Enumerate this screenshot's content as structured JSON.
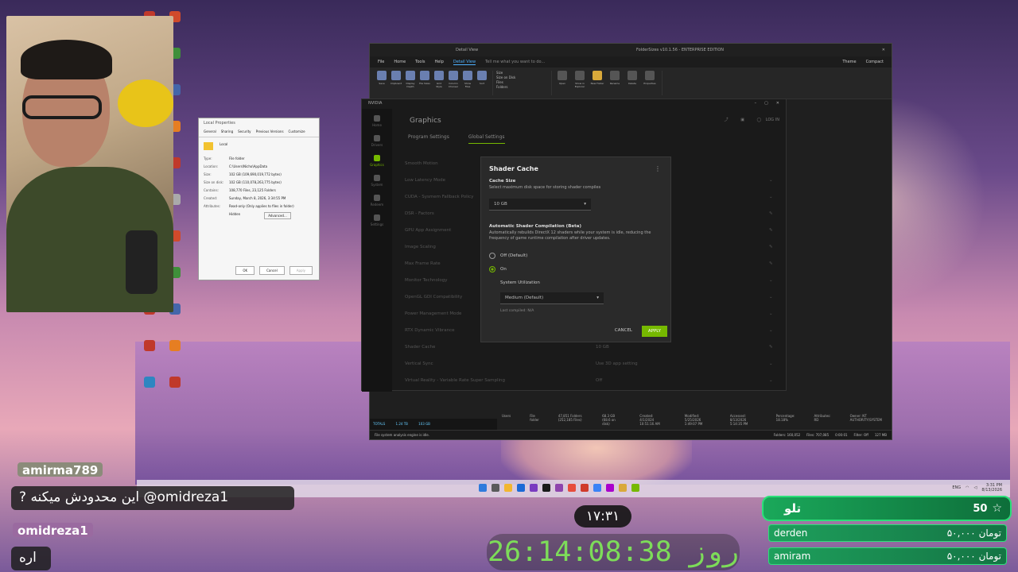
{
  "desktop": {
    "icons": [
      "",
      "",
      "",
      "",
      "",
      "",
      "",
      "",
      "",
      "",
      "",
      "",
      "",
      "",
      "",
      "",
      "",
      "",
      "",
      "",
      "",
      ""
    ]
  },
  "properties_dialog": {
    "title": "Local Properties",
    "tabs": [
      "General",
      "Sharing",
      "Security",
      "Previous Versions",
      "Customize"
    ],
    "folder_name": "Local",
    "rows": [
      {
        "k": "Type:",
        "v": "File folder"
      },
      {
        "k": "Location:",
        "v": "C:\\Users\\Nicho\\AppData"
      },
      {
        "k": "Size:",
        "v": "102 GB (109,690,019,772 bytes)"
      },
      {
        "k": "Size on disk:",
        "v": "102 GB (110,078,263,775 bytes)"
      },
      {
        "k": "Contains:",
        "v": "108,770 Files, 23,125 Folders"
      },
      {
        "k": "Created:",
        "v": "Sunday, March 8, 2026, 3:34:55 PM"
      },
      {
        "k": "Attributes:",
        "v": "Read-only (Only applies to files in folder)"
      }
    ],
    "hidden_label": "Hidden",
    "advanced_label": "Advanced...",
    "ok": "OK",
    "cancel": "Cancel",
    "apply": "Apply"
  },
  "foldersizes": {
    "title": "FolderSizes v10.1.56 - ENTERPRISE EDITION",
    "ribbon_tab": "Detail View",
    "search_placeholder": "Tell me what you want to do...",
    "theme": "Theme",
    "compact": "Compact",
    "menu": [
      "File",
      "Home",
      "Tools",
      "Help",
      "Detail View"
    ],
    "ribbon_buttons": [
      "Save",
      "Clipboard",
      "Display Depth",
      "File Sizes",
      "Grid Style",
      "Column Chooser",
      "Show Files",
      "Sort"
    ],
    "ribbon_checks": [
      "Size",
      "Size on Disk",
      "Files",
      "Folders"
    ],
    "ribbon_actions": [
      "Open",
      "Show in Explorer",
      "New Folder",
      "Rename",
      "Delete",
      "Properties"
    ],
    "group_labels": [
      "Detail Report",
      "Heat Tint",
      "Actions"
    ],
    "bottom_left": [
      "TOTALS",
      "1.24 TB",
      "103 GB"
    ],
    "info": [
      "Users",
      "File folder",
      "47,851 Folders (252,185 Files)",
      "68.3 GB (68.6 on disk)",
      "Created: 4/1/2024 10:51:16 AM",
      "Modified: 5/25/2026 1:49:07 PM",
      "Accessed: 8/13/2026 5:14:35 PM",
      "Percentage: 18.18%",
      "Attributes: RD",
      "Owner: NT AUTHORITY\\SYSTEM"
    ],
    "status": "File system analysis engine is idle.",
    "status_right": [
      "Folders: 160,052",
      "Files: 707,085",
      "0:00:01",
      "Filter: Off",
      "127 MB"
    ]
  },
  "nvidia": {
    "brand": "NVIDIA",
    "header": "Graphics",
    "login": "LOG IN",
    "sidebar": [
      "Home",
      "Drivers",
      "Graphics",
      "System",
      "Redeem",
      "Settings"
    ],
    "tabs": [
      "Program Settings",
      "Global Settings"
    ],
    "rows": [
      {
        "name": "Smooth Motion",
        "val": "",
        "ed": ""
      },
      {
        "name": "Low Latency Mode",
        "val": "",
        "ed": "⌄"
      },
      {
        "name": "CUDA - Sysmem Fallback Policy",
        "val": "",
        "ed": "⌄"
      },
      {
        "name": "DSR - Factors",
        "val": "",
        "ed": "✎"
      },
      {
        "name": "GPU App Assignment",
        "val": "",
        "ed": "✎"
      },
      {
        "name": "Image Scaling",
        "val": "",
        "ed": "✎"
      },
      {
        "name": "Max Frame Rate",
        "val": "",
        "ed": "✎"
      },
      {
        "name": "Monitor Technology",
        "val": "",
        "ed": "⌄"
      },
      {
        "name": "OpenGL GDI Compatibility",
        "val": "",
        "ed": "⌄"
      },
      {
        "name": "Power Management Mode",
        "val": "",
        "ed": "⌄"
      },
      {
        "name": "RTX Dynamic Vibrance",
        "val": "",
        "ed": "⌄"
      },
      {
        "name": "Shader Cache",
        "val": "10 GB",
        "ed": "✎"
      },
      {
        "name": "Vertical Sync",
        "val": "Use 3D app setting",
        "ed": "⌄"
      },
      {
        "name": "Virtual Reality - Variable Rate Super Sampling",
        "val": "Off",
        "ed": "⌄"
      }
    ]
  },
  "shader_modal": {
    "title": "Shader Cache",
    "cache_size_label": "Cache Size",
    "cache_size_desc": "Select maximum disk space for storing shader compiles",
    "cache_size_value": "10 GB",
    "auto_label": "Automatic Shader Compilation (Beta)",
    "auto_desc": "Automatically rebuilds DirectX 12 shaders while your system is idle, reducing the frequency of game runtime compilation after driver updates.",
    "opt_off": "Off (Default)",
    "opt_on": "On",
    "util_label": "System Utilization",
    "util_value": "Medium (Default)",
    "last_compiled": "Last compiled: N/A",
    "cancel": "CANCEL",
    "apply": "APPLY"
  },
  "taskbar": {
    "tray": [
      "ENG",
      "3:31 PM",
      "8/13/2026"
    ]
  },
  "chat": [
    {
      "user": "amirma789",
      "msg": "? این محدودش میکنه @omidreza1",
      "user_color": "#8b8b7a"
    },
    {
      "user": "omidreza1",
      "msg": "اره",
      "user_color": "#9a6aa0"
    }
  ],
  "timers": {
    "small": "۱۷:۳۱",
    "big": "26:14:08:38 روز"
  },
  "donations": {
    "title": "تلو",
    "count": "50",
    "star": "☆",
    "rows": [
      {
        "name": "derden",
        "amount": "۵۰,۰۰۰ تومان"
      },
      {
        "name": "amiram",
        "amount": "۵۰,۰۰۰ تومان"
      }
    ]
  }
}
